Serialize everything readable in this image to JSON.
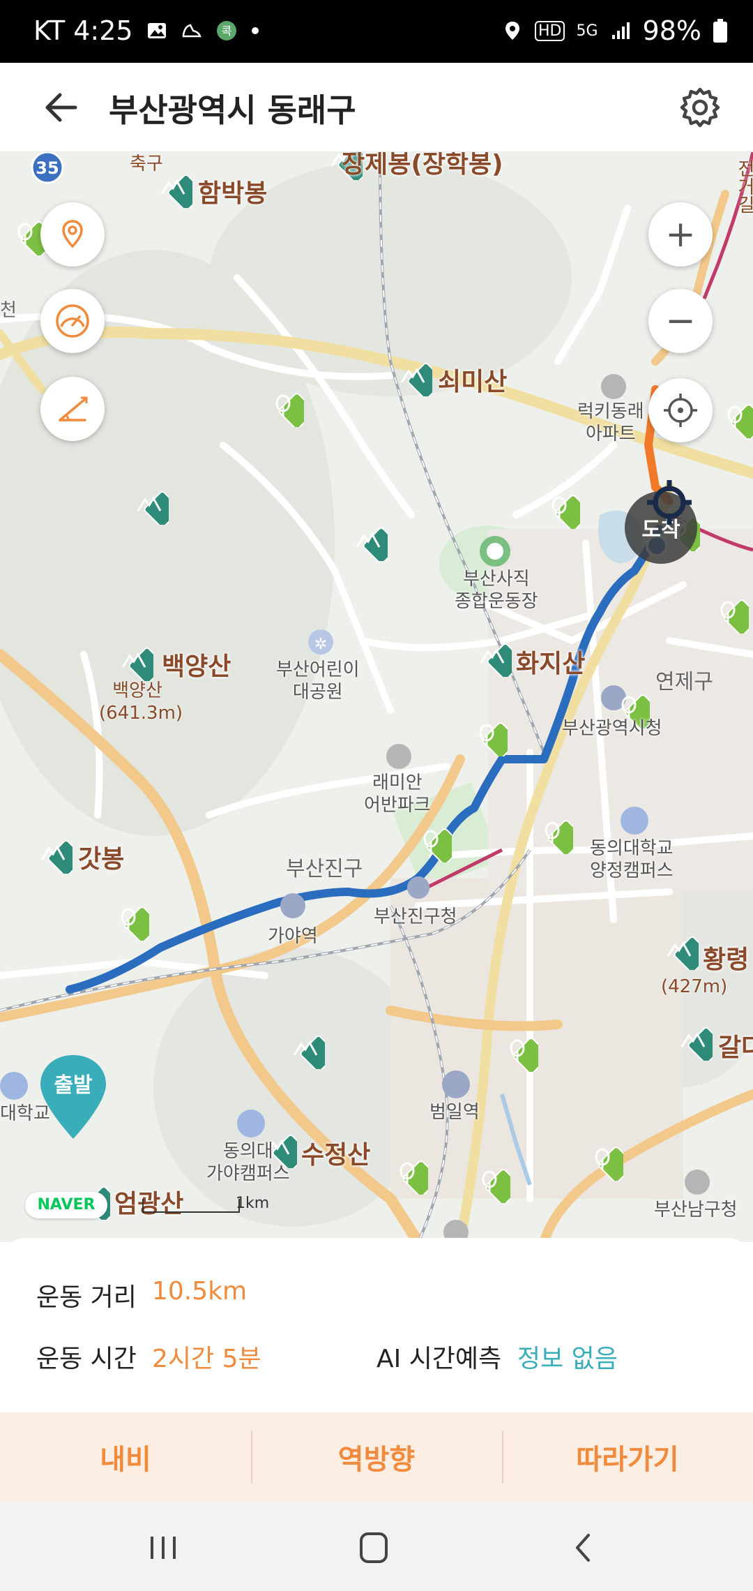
{
  "status_bar": {
    "carrier_time": "KT 4:25",
    "battery": "98%",
    "network": "5G",
    "hd": "HD"
  },
  "header": {
    "title": "부산광역시 동래구",
    "back_icon": "arrow-left-icon",
    "settings_icon": "gear-icon"
  },
  "map": {
    "route_number": "35",
    "mountains": [
      {
        "name": "함박봉"
      },
      {
        "name": "쇠미산"
      },
      {
        "name": "백양산",
        "sub": "백양산\n(641.3m)"
      },
      {
        "name": "화지산"
      },
      {
        "name": "갓봉"
      },
      {
        "name": "수정산"
      },
      {
        "name": "엄광산"
      },
      {
        "name": "황령"
      },
      {
        "name": "갈다"
      }
    ],
    "top_label": "장제봉(장학봉)",
    "partial_top_left": "축구",
    "partial_left": "천",
    "partial_right": "전거길",
    "hwangryeong_sub": "(427m)",
    "pois": {
      "stadium": "부산사직\n종합운동장",
      "childrens_park": "부산어린이\n대공원",
      "raemian": "래미안\n어반파크",
      "lucky_apt": "럭키동래\n아파트",
      "city_hall": "부산광역시청",
      "dongeui_campus": "동의대학교\n양정캠퍼스",
      "busanjin_office": "부산진구청",
      "gaya_station": "가야역",
      "beomil_station": "범일역",
      "dongeui_gaya": "동의대\n가야캠퍼스",
      "nam_office": "부산남구청",
      "left_univ": "대학교"
    },
    "districts": {
      "busanjin": "부산진구",
      "yeonje": "연제구"
    },
    "start_label": "출발",
    "arrive_label": "도착",
    "naver": "NAVER",
    "scale": "1km",
    "controls": {
      "zoom_in": "+",
      "zoom_out": "−"
    }
  },
  "info": {
    "distance_label": "운동 거리",
    "distance_value": "10.5km",
    "time_label": "운동 시간",
    "time_value": "2시간 5분",
    "ai_label": "AI 시간예측",
    "ai_value": "정보 없음"
  },
  "actions": {
    "navigate": "내비",
    "reverse": "역방향",
    "follow": "따라가기"
  },
  "colors": {
    "accent": "#f08a3c",
    "teal": "#3aadbb",
    "route": "#2a6dbf",
    "mountain": "#2e8b7a"
  }
}
